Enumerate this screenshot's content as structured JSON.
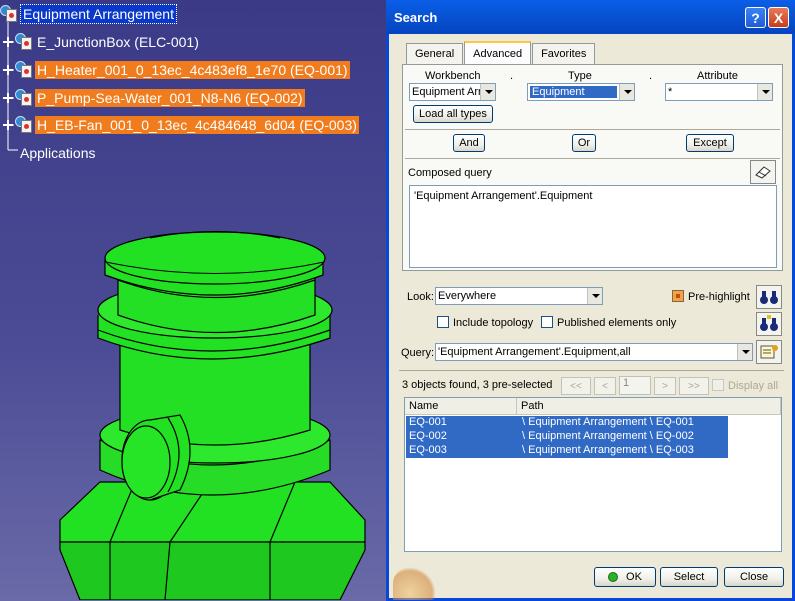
{
  "tree": {
    "root": "Equipment Arrangement",
    "items": [
      "E_JunctionBox (ELC-001)",
      "H_Heater_001_0_13ec_4c483ef8_1e70 (EQ-001)",
      "P_Pump-Sea-Water_001_N8-N6 (EQ-002)",
      "H_EB-Fan_001_0_13ec_4c484648_6d04 (EQ-003)"
    ],
    "applications": "Applications"
  },
  "dialog": {
    "title": "Search",
    "help_icon": "?",
    "close_icon": "X",
    "tabs": [
      "General",
      "Advanced",
      "Favorites"
    ],
    "active_tab": "Advanced",
    "workbench_label": "Workbench",
    "type_label": "Type",
    "attribute_label": "Attribute",
    "separator": ".",
    "workbench_value": "Equipment Arr",
    "type_value": "Equipment",
    "attribute_value": "*",
    "load_all_types": "Load all types",
    "and_label": "And",
    "or_label": "Or",
    "except_label": "Except",
    "composed_query_label": "Composed query",
    "composed_query_value": "'Equipment Arrangement'.Equipment",
    "look_label": "Look:",
    "look_value": "Everywhere",
    "pre_highlight_label": "Pre-highlight",
    "include_topology_label": "Include topology",
    "published_only_label": "Published elements only",
    "query_label": "Query:",
    "query_value": "'Equipment Arrangement'.Equipment,all",
    "status": "3 objects found, 3 pre-selected",
    "nav_first": "<<",
    "nav_prev": "<",
    "page_value": "1",
    "nav_next": ">",
    "nav_last": ">>",
    "display_all_label": "Display all",
    "columns": [
      "Name",
      "Path"
    ],
    "rows": [
      {
        "name": "EQ-001",
        "path": "\\ Equipment Arrangement \\ EQ-001"
      },
      {
        "name": "EQ-002",
        "path": "\\ Equipment Arrangement \\ EQ-002"
      },
      {
        "name": "EQ-003",
        "path": "\\ Equipment Arrangement \\ EQ-003"
      }
    ],
    "ok_label": "OK",
    "select_label": "Select",
    "close_label": "Close"
  },
  "colors": {
    "background": "#3a3a86",
    "model_green": "#22e022",
    "selection_orange": "#f07c1e",
    "selection_blue": "#0a38c8",
    "title_bar": "#0856d8"
  }
}
